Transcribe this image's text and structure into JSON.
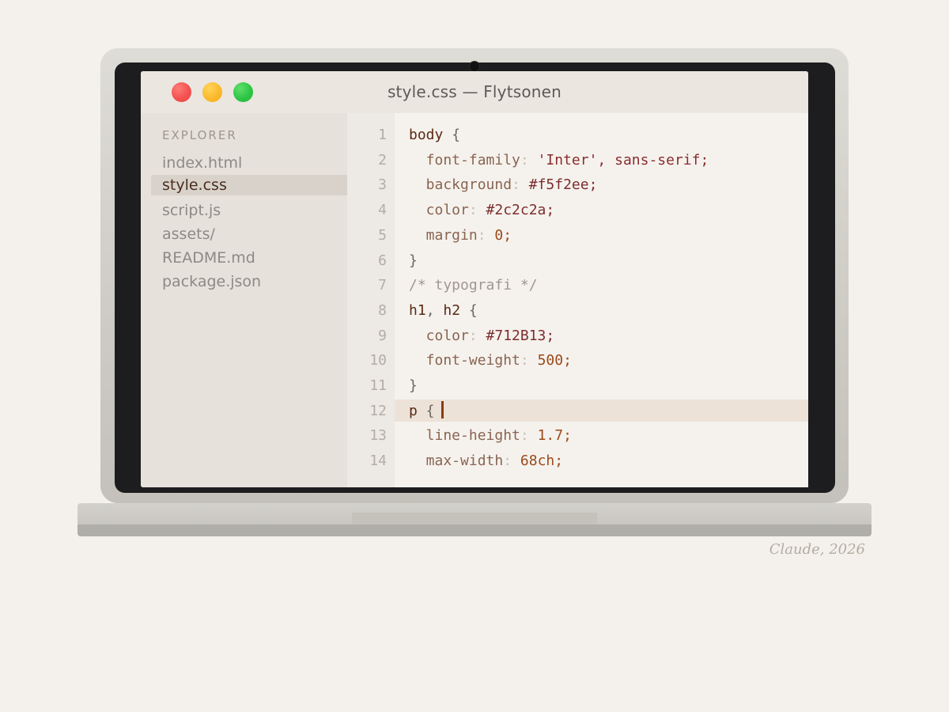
{
  "window": {
    "title": "style.css — Flytsonen"
  },
  "sidebar": {
    "header": "EXPLORER",
    "files": [
      {
        "name": "index.html",
        "active": false
      },
      {
        "name": "style.css",
        "active": true
      },
      {
        "name": "script.js",
        "active": false
      },
      {
        "name": "assets/",
        "active": false
      },
      {
        "name": "README.md",
        "active": false
      },
      {
        "name": "package.json",
        "active": false
      }
    ]
  },
  "editor": {
    "active_line": 12,
    "lines": [
      {
        "n": "1",
        "tokens": [
          [
            "sel",
            "body"
          ],
          [
            "brace",
            " {"
          ]
        ]
      },
      {
        "n": "2",
        "tokens": [
          [
            "prop",
            "  font-family"
          ],
          [
            "colon",
            ":"
          ],
          [
            "str",
            " 'Inter', sans-serif;"
          ]
        ]
      },
      {
        "n": "3",
        "tokens": [
          [
            "prop",
            "  background"
          ],
          [
            "colon",
            ":"
          ],
          [
            "hex",
            " #f5f2ee;"
          ]
        ]
      },
      {
        "n": "4",
        "tokens": [
          [
            "prop",
            "  color"
          ],
          [
            "colon",
            ":"
          ],
          [
            "hex",
            " #2c2c2a;"
          ]
        ]
      },
      {
        "n": "5",
        "tokens": [
          [
            "prop",
            "  margin"
          ],
          [
            "colon",
            ":"
          ],
          [
            "num",
            " 0;"
          ]
        ]
      },
      {
        "n": "6",
        "tokens": [
          [
            "brace",
            "}"
          ]
        ]
      },
      {
        "n": "7",
        "tokens": [
          [
            "cmt",
            "/* typografi */"
          ]
        ]
      },
      {
        "n": "8",
        "tokens": [
          [
            "sel",
            "h1"
          ],
          [
            "brace",
            ", "
          ],
          [
            "sel",
            "h2"
          ],
          [
            "brace",
            " {"
          ]
        ]
      },
      {
        "n": "9",
        "tokens": [
          [
            "prop",
            "  color"
          ],
          [
            "colon",
            ":"
          ],
          [
            "hex",
            " #712B13;"
          ]
        ]
      },
      {
        "n": "10",
        "tokens": [
          [
            "prop",
            "  font-weight"
          ],
          [
            "colon",
            ":"
          ],
          [
            "num",
            " 500;"
          ]
        ]
      },
      {
        "n": "11",
        "tokens": [
          [
            "brace",
            "}"
          ]
        ]
      },
      {
        "n": "12",
        "tokens": [
          [
            "sel",
            "p"
          ],
          [
            "brace",
            " {"
          ]
        ]
      },
      {
        "n": "13",
        "tokens": [
          [
            "prop",
            "  line-height"
          ],
          [
            "colon",
            ":"
          ],
          [
            "num",
            " 1.7;"
          ]
        ]
      },
      {
        "n": "14",
        "tokens": [
          [
            "prop",
            "  max-width"
          ],
          [
            "colon",
            ":"
          ],
          [
            "num",
            " 68ch;"
          ]
        ]
      }
    ]
  },
  "signature": "Claude, 2026",
  "colors": {
    "close": "#f25250",
    "minimize": "#fbb92c",
    "zoom": "#2ec545",
    "accent": "#712B13"
  }
}
